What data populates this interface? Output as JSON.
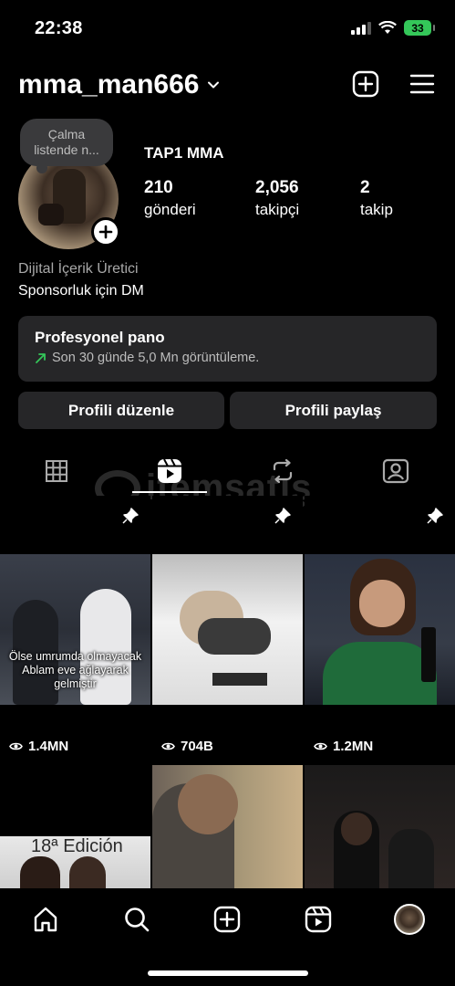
{
  "status": {
    "time": "22:38",
    "battery": "33"
  },
  "header": {
    "username": "mma_man666"
  },
  "profile": {
    "note": "Çalma listende n...",
    "display_name": "TAP1 MMA",
    "stats": [
      {
        "value": "210",
        "label": "gönderi"
      },
      {
        "value": "2,056",
        "label": "takipçi"
      },
      {
        "value": "2",
        "label": "takip"
      }
    ],
    "category": "Dijital İçerik Üretici",
    "bio": "Sponsorluk için DM"
  },
  "dashboard": {
    "title": "Profesyonel pano",
    "subtitle": "Son 30 günde 5,0 Mn görüntüleme."
  },
  "actions": {
    "edit": "Profili düzenle",
    "share": "Profili paylaş"
  },
  "watermark": "itemsatış",
  "tabs": [
    {
      "icon": "grid-icon",
      "active": false
    },
    {
      "icon": "reels-icon",
      "active": true
    },
    {
      "icon": "reposts-icon",
      "active": false
    },
    {
      "icon": "tagged-icon",
      "active": false
    }
  ],
  "grid": {
    "row1": [
      {
        "views": "1.4MN",
        "pinned": true,
        "caption_line1": "Ölse umrumda olmayacak",
        "caption_line2": "Ablam eve ağlayarak",
        "caption_line3": "gelmiştir"
      },
      {
        "views": "704B",
        "pinned": true
      },
      {
        "views": "1.2MN",
        "pinned": true
      }
    ],
    "row2_text": "18ª Edición"
  },
  "colors": {
    "background": "#000000",
    "card": "#262628",
    "accent_green": "#34c759"
  }
}
